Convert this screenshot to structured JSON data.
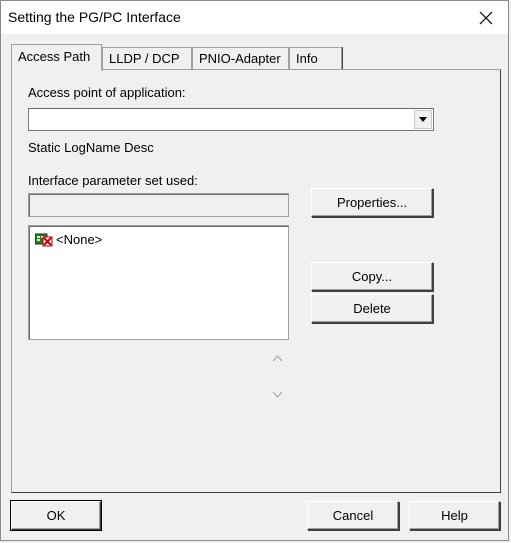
{
  "window": {
    "title": "Setting the PG/PC Interface"
  },
  "tabs": [
    {
      "label": "Access Path",
      "active": true
    },
    {
      "label": "LLDP / DCP",
      "active": false
    },
    {
      "label": "PNIO-Adapter",
      "active": false
    },
    {
      "label": "Info",
      "active": false
    }
  ],
  "access_path": {
    "access_point_label": "Access point of application:",
    "access_point_value": "",
    "static_logname": "Static LogName Desc",
    "param_set_label": "Interface parameter set used:",
    "param_set_value": "",
    "list_items": [
      {
        "label": "<None>",
        "icon": "network-adapter-none-icon"
      }
    ],
    "properties_button": "Properties...",
    "copy_button": "Copy...",
    "delete_button": "Delete"
  },
  "footer": {
    "ok_button": "OK",
    "cancel_button": "Cancel",
    "help_button": "Help"
  },
  "colors": {
    "background": "#f0f0f0",
    "titlebar": "#ffffff",
    "border": "#a0a0a0"
  }
}
